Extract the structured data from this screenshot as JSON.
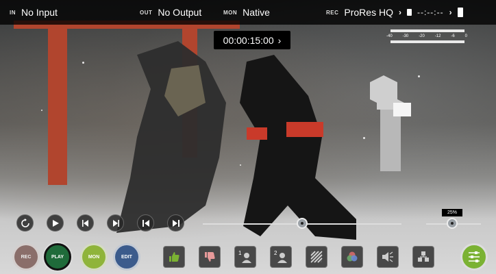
{
  "topbar": {
    "input_tag": "IN",
    "input_value": "No Input",
    "output_tag": "OUT",
    "output_value": "No Output",
    "monitor_tag": "MON",
    "monitor_value": "Native",
    "record_tag": "REC",
    "record_value": "ProRes HQ",
    "record_time": "--:--:--"
  },
  "timecode": {
    "value": "00:00:15:00",
    "chevron": "›"
  },
  "audio_meter": {
    "ticks": [
      "-40",
      "-30",
      "-20",
      "-12",
      "-6",
      "0"
    ]
  },
  "transport": {
    "buttons": [
      "loop-icon",
      "play-icon",
      "prev-frame-icon",
      "next-frame-icon",
      "skip-start-icon",
      "skip-end-icon"
    ],
    "playhead_position": 0.5
  },
  "zoom": {
    "label": "25%",
    "value": 0.25
  },
  "modes": {
    "rec": "REC",
    "play": "PLAY",
    "mon": "MON",
    "edit": "EDIT"
  },
  "tools": [
    "thumbs-up-icon",
    "thumbs-down-icon",
    "input-1-icon",
    "input-2-icon",
    "zebra-icon",
    "color-channels-icon",
    "audio-icon",
    "layout-icon"
  ],
  "colors": {
    "accent_green": "#7bb233",
    "play_green": "#1f6b3a",
    "mon_green": "#8fb43a",
    "edit_blue": "#3b5b8c",
    "rec_muted": "#8a6e6a"
  }
}
